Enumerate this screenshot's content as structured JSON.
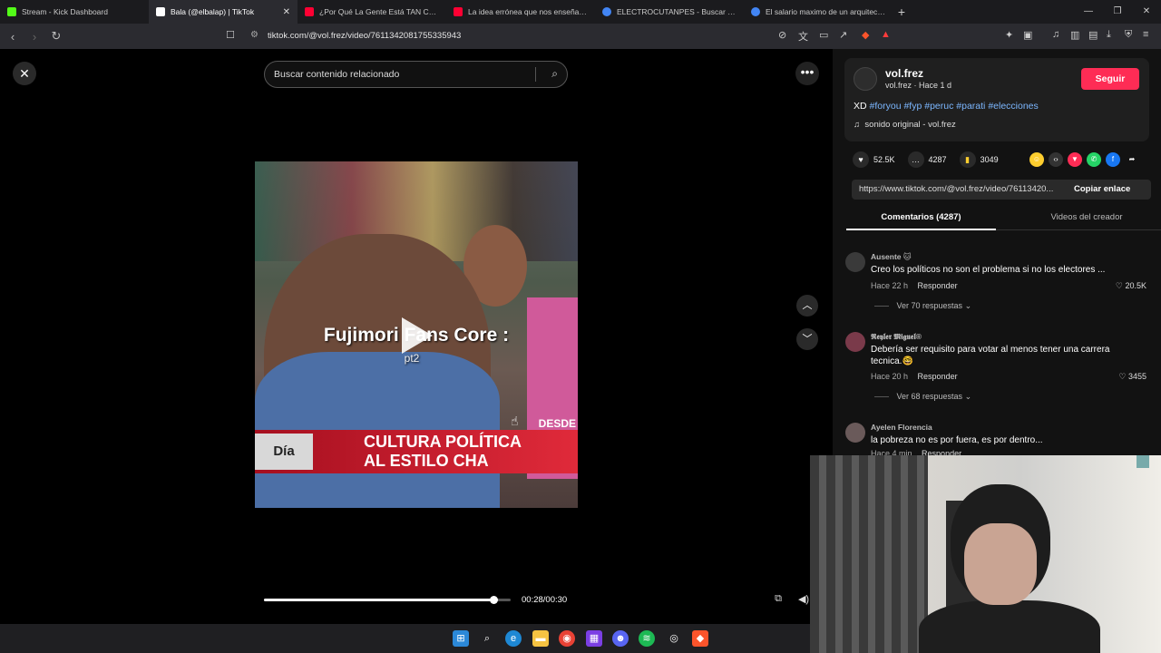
{
  "browser": {
    "tabs": [
      {
        "title": "Stream - Kick Dashboard",
        "favicon_color": "#53fc18"
      },
      {
        "title": "Bala (@elbalap) | TikTok",
        "favicon_color": "#ffffff",
        "active": true
      },
      {
        "title": "¿Por Qué La Gente Está TAN Confiad",
        "favicon_color": "#ff0033"
      },
      {
        "title": "La idea errónea que nos enseñan so",
        "favicon_color": "#ff0033"
      },
      {
        "title": "ELECTROCUTANPES - Buscar con Goo",
        "favicon_color": "#4285f4"
      },
      {
        "title": "El salario maximo de un arquitecto -",
        "favicon_color": "#4285f4"
      }
    ],
    "url": "tiktok.com/@vol.frez/video/7611342081755335943"
  },
  "player": {
    "search_placeholder": "Buscar contenido relacionado",
    "caption": "Fujimori Fans Core :",
    "caption_sub": "pt2",
    "overlay_desde": "DESDE",
    "ticker_day": "Día",
    "ticker_line1": "CULTURA POLÍTICA",
    "ticker_line2": "AL ESTILO CHA",
    "time": "00:28/00:30",
    "progress": 0.93
  },
  "post": {
    "username": "vol.frez",
    "meta": "vol.frez · Hace 1 d",
    "follow_label": "Seguir",
    "desc_prefix": "XD",
    "hashtags": [
      "#foryou",
      "#fyp",
      "#peruᴄ",
      "#parati",
      "#elecciones"
    ],
    "sound": "sonido original - vol.frez",
    "likes": "52.5K",
    "comments": "4287",
    "saves": "3049",
    "link": "https://www.tiktok.com/@vol.frez/video/76113420...",
    "copy_label": "Copiar enlace",
    "tab_comments": "Comentarios (4287)",
    "tab_creator": "Videos del creador"
  },
  "comments": [
    {
      "name": "Ausente 🐱",
      "text": "Creo los políticos no son el problema si no los electores ...",
      "time": "Hace 22 h",
      "reply": "Responder",
      "likes": "20.5K",
      "replies": "Ver 70 respuestas"
    },
    {
      "name": "𝕽𝖊𝖞𝖑𝖊𝖗 𝕸𝖎𝖌𝖚𝖊𝖑®",
      "text": "Debería ser requisito para votar al menos tener una carrera tecnica.🤓",
      "time": "Hace 20 h",
      "reply": "Responder",
      "likes": "3455",
      "replies": "Ver 68 respuestas"
    },
    {
      "name": "Ayelen Florencia",
      "text": "la pobreza no es por fuera, es por dentro...",
      "time": "Hace 4 min",
      "reply": "Responder"
    }
  ]
}
